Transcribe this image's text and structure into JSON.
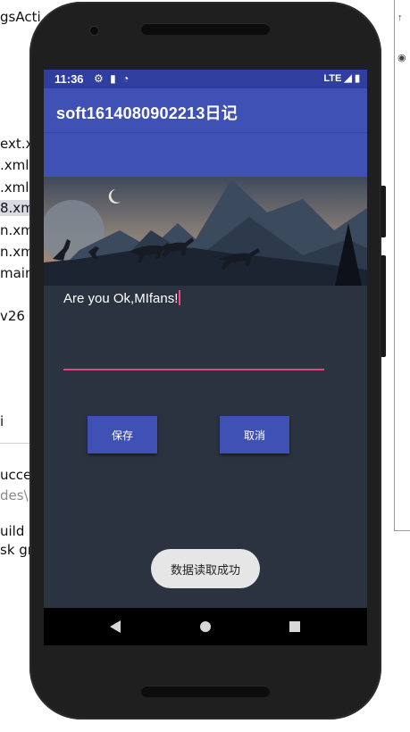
{
  "ide": {
    "left_lines": [
      "gsActi",
      "ext.x",
      ".xml",
      ".xml",
      "8.xm",
      "n.xm",
      "n.xm",
      "main.",
      "v26",
      "i",
      "ucce",
      "des\\",
      "uild",
      "sk gra"
    ]
  },
  "statusbar": {
    "time": "11:36",
    "network": "LTE"
  },
  "appbar": {
    "title": "soft1614080902213日记"
  },
  "main": {
    "greeting": "Are you Ok,MIfans!",
    "input_value": "",
    "save_label": "保存",
    "cancel_label": "取消",
    "toast": "数据读取成功"
  },
  "colors": {
    "primary": "#3f51b5",
    "primary_dark": "#303f9f",
    "accent": "#ff4081",
    "background": "#2b3341"
  }
}
